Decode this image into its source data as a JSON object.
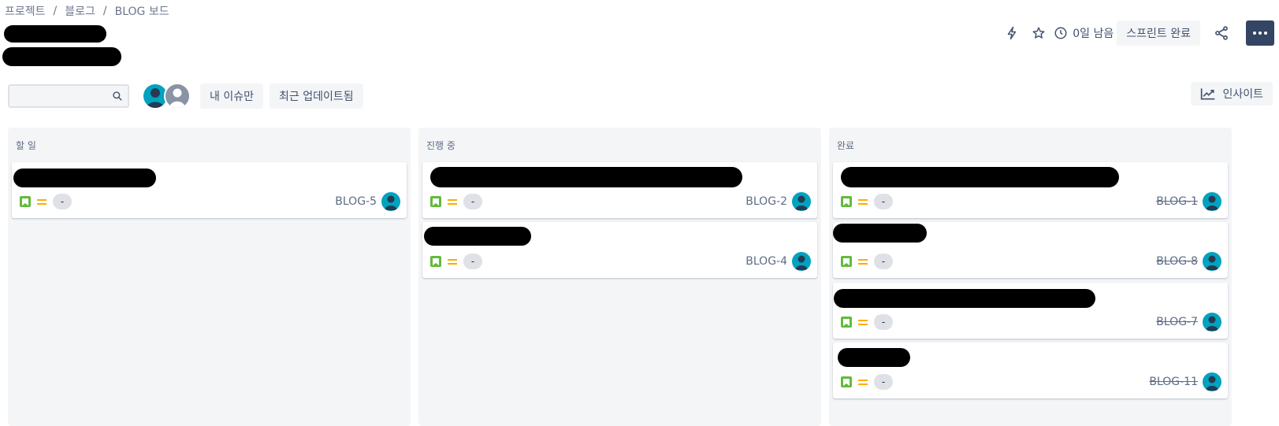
{
  "breadcrumb": {
    "items": [
      "프로젝트",
      "블로그",
      "BLOG 보드"
    ],
    "separator": "/"
  },
  "header": {
    "time_remaining": "0일 남음",
    "complete_sprint_label": "스프린트 완료"
  },
  "filters": {
    "search_value": "",
    "only_my_issues_label": "내 이슈만",
    "recently_updated_label": "최근 업데이트됨",
    "insights_label": "인사이트"
  },
  "columns": [
    {
      "title": "할 일",
      "cards": [
        {
          "key": "BLOG-5",
          "story_points": "-",
          "done": false
        }
      ]
    },
    {
      "title": "진행 중",
      "cards": [
        {
          "key": "BLOG-2",
          "story_points": "-",
          "done": false
        },
        {
          "key": "BLOG-4",
          "story_points": "-",
          "done": false
        }
      ]
    },
    {
      "title": "완료",
      "cards": [
        {
          "key": "BLOG-1",
          "story_points": "-",
          "done": true
        },
        {
          "key": "BLOG-8",
          "story_points": "-",
          "done": true
        },
        {
          "key": "BLOG-7",
          "story_points": "-",
          "done": true
        },
        {
          "key": "BLOG-11",
          "story_points": "-",
          "done": true
        }
      ]
    }
  ],
  "colors": {
    "column_bg": "#f4f5f7",
    "avatar_teal": "#00a3bf",
    "story_green": "#63ba3c",
    "priority_medium": "#ffab00",
    "more_button": "#344563"
  },
  "icons": {
    "automation": "lightning-icon",
    "star": "star-icon",
    "clock": "clock-icon",
    "share": "share-icon",
    "more": "more-icon",
    "search": "search-icon",
    "insights": "chart-trend-icon",
    "issue_type": "story-bookmark-icon",
    "priority": "priority-medium-icon"
  }
}
